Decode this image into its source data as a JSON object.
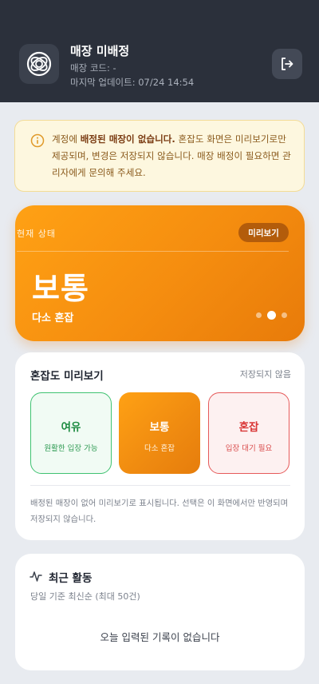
{
  "header": {
    "store_name": "매장 미배정",
    "store_code": "매장 코드: -",
    "last_update": "마지막 업데이트: 07/24 14:54",
    "logo_icon": "concentric-rings-logo-icon",
    "logout_icon": "logout-icon"
  },
  "notice": {
    "prefix": "계정에 ",
    "bold": "배정된 매장이 없습니다.",
    "body": " 혼잡도 화면은 미리보기로만 제공되며, 변경은 저장되지 않습니다. 매장 배정이 필요하면 관리자에게 문의해 주세요.",
    "icon": "info-icon"
  },
  "status": {
    "label": "현재 상태",
    "badge": "미리보기",
    "value": "보통",
    "description": "다소 혼잡",
    "active_page": 2,
    "page_count": 3
  },
  "preview": {
    "title": "혼잡도 미리보기",
    "note": "저장되지 않음",
    "options": [
      {
        "label": "여유",
        "sub": "원활한 입장 가능"
      },
      {
        "label": "보통",
        "sub": "다소 혼잡"
      },
      {
        "label": "혼잡",
        "sub": "입장 대기 필요"
      }
    ],
    "selected": "보통",
    "footer": "배정된 매장이 없어 미리보기로 표시됩니다. 선택은 이 화면에서만 반영되며 저장되지 않습니다."
  },
  "activity": {
    "title": "최근 활동",
    "subtitle": "당일 기준 최신순 (최대 50건)",
    "empty": "오늘 입력된 기록이 없습니다",
    "icon": "activity-pulse-icon"
  },
  "colors": {
    "header_bg": "#2b303b",
    "accent_orange": "#f58d0f",
    "green": "#3fc271",
    "red": "#e65a5a",
    "notice_bg": "#fdf7df"
  }
}
